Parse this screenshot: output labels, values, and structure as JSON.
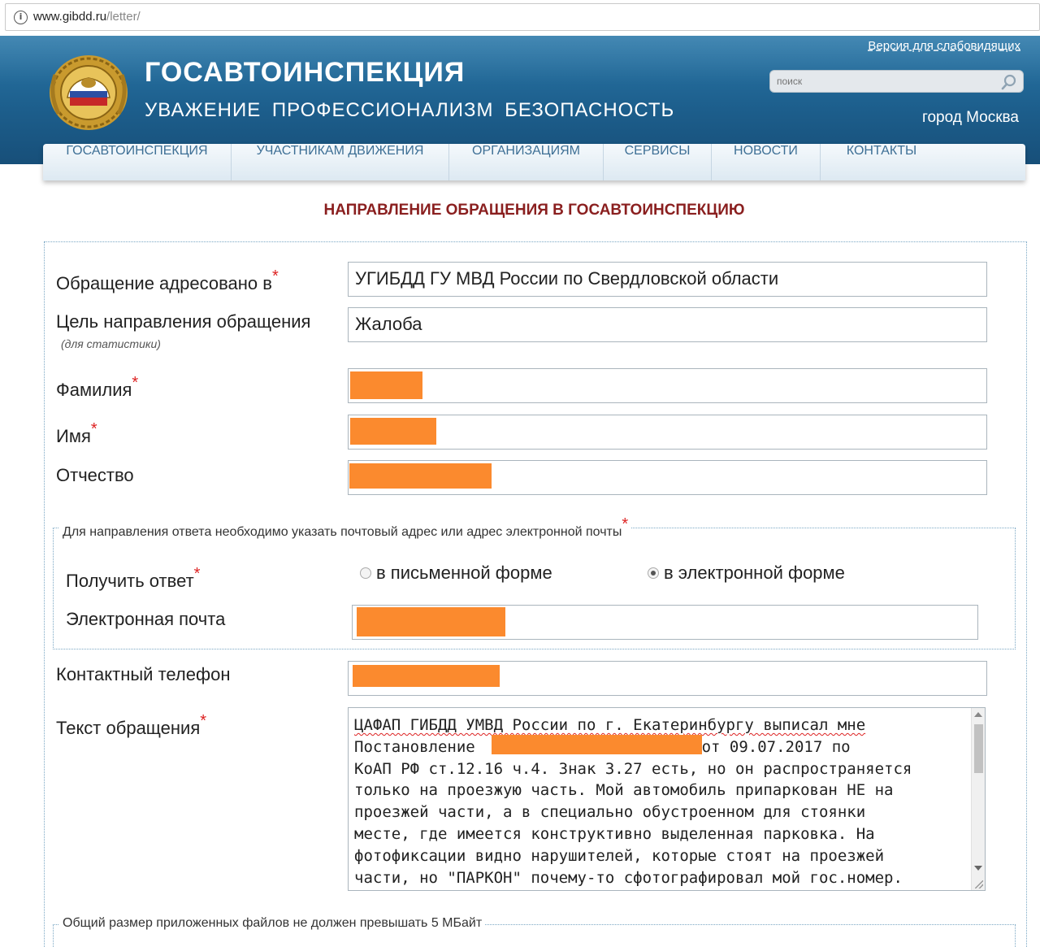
{
  "browser": {
    "url_host": "www.gibdd.ru",
    "url_path": "/letter/"
  },
  "header": {
    "title": "ГОСАВТОИНСПЕКЦИЯ",
    "slogan": "УВАЖЕНИЕ  ПРОФЕССИОНАЛИЗМ  БЕЗОПАСНОСТЬ",
    "a11y_link": "Версия для слабовидящих",
    "search_placeholder": "поиск",
    "city": "город Москва"
  },
  "nav": {
    "items": [
      {
        "label": "ГОСАВТОИНСПЕКЦИЯ"
      },
      {
        "label": "УЧАСТНИКАМ ДВИЖЕНИЯ"
      },
      {
        "label": "ОРГАНИЗАЦИЯМ"
      },
      {
        "label": "СЕРВИСЫ"
      },
      {
        "label": "НОВОСТИ"
      },
      {
        "label": "КОНТАКТЫ"
      }
    ]
  },
  "form": {
    "heading": "НАПРАВЛЕНИЕ ОБРАЩЕНИЯ В ГОСАВТОИНСПЕКЦИЮ",
    "required_mark": "*",
    "addressee_label": "Обращение адресовано в",
    "addressee_value": "УГИБДД ГУ МВД России по Свердловской области",
    "purpose_label": "Цель направления обращения",
    "purpose_hint": "(для статистики)",
    "purpose_value": "Жалоба",
    "surname_label": "Фамилия",
    "name_label": "Имя",
    "patronymic_label": "Отчество",
    "reply_legend": "Для направления ответа необходимо указать почтовый адрес или адрес электронной почты",
    "reply_label": "Получить ответ",
    "reply_options": [
      {
        "label": "в письменной форме",
        "checked": false
      },
      {
        "label": "в электронной форме",
        "checked": true
      }
    ],
    "email_label": "Электронная почта",
    "phone_label": "Контактный телефон",
    "message_label": "Текст обращения",
    "message_lines": [
      [
        "ЦАФАП ГИБДД УМВД России по г. Екатеринбургу выписал мне"
      ],
      [
        "Постановление ",
        " от 09.07.2017 по"
      ],
      [
        "КоАП РФ ст.12.16 ч.4. Знак 3.27 есть, но он распространяется"
      ],
      [
        "только на проезжую часть. Мой автомобиль припаркован НЕ на"
      ],
      [
        "проезжей части, а в специально обустроенном для стоянки"
      ],
      [
        "месте, где имеется конструктивно выделенная парковка. На"
      ],
      [
        "фотофиксации видно нарушителей, которые стоят на проезжей"
      ],
      [
        "части, но \"ПАРКОН\" почему-то сфотографировал мой гос.номер."
      ]
    ],
    "files_legend": "Общий размер приложенных файлов не должен превышать 5 МБайт"
  },
  "colors": {
    "header_blue": "#1d5f8d",
    "heading_red": "#8a1f1f",
    "redaction_orange": "#fb8a2e",
    "nav_text": "#3d6f95"
  }
}
